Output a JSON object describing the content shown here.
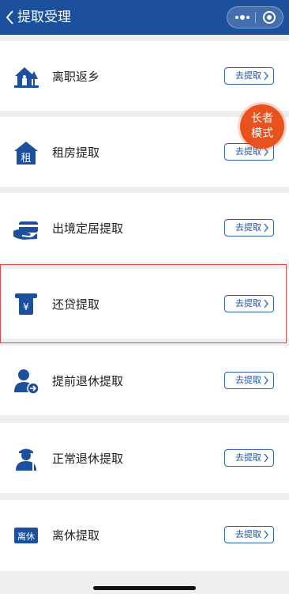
{
  "header": {
    "back_icon": "chevron-left-icon",
    "title": "提取受理",
    "more_icon": "more-dots-icon",
    "close_icon": "target-circle-icon"
  },
  "elder_mode": {
    "line1": "长者",
    "line2": "模式"
  },
  "items": [
    {
      "label": "离职返乡",
      "button": "去提取",
      "icon": "house-trees-icon"
    },
    {
      "label": "租房提取",
      "button": "去提取",
      "icon": "house-rent-icon"
    },
    {
      "label": "出境定居提取",
      "button": "去提取",
      "icon": "hand-card-icon"
    },
    {
      "label": "还贷提取",
      "button": "去提取",
      "icon": "atm-yuan-icon"
    },
    {
      "label": "提前退休提取",
      "button": "去提取",
      "icon": "person-arrow-icon"
    },
    {
      "label": "正常退休提取",
      "button": "去提取",
      "icon": "retiree-icon"
    },
    {
      "label": "离休提取",
      "button": "去提取",
      "icon": "retire-badge-icon",
      "icon_text": "离休"
    }
  ],
  "colors": {
    "primary": "#1c4f9c",
    "accent": "#e8521f",
    "highlight": "#e24a4a"
  }
}
